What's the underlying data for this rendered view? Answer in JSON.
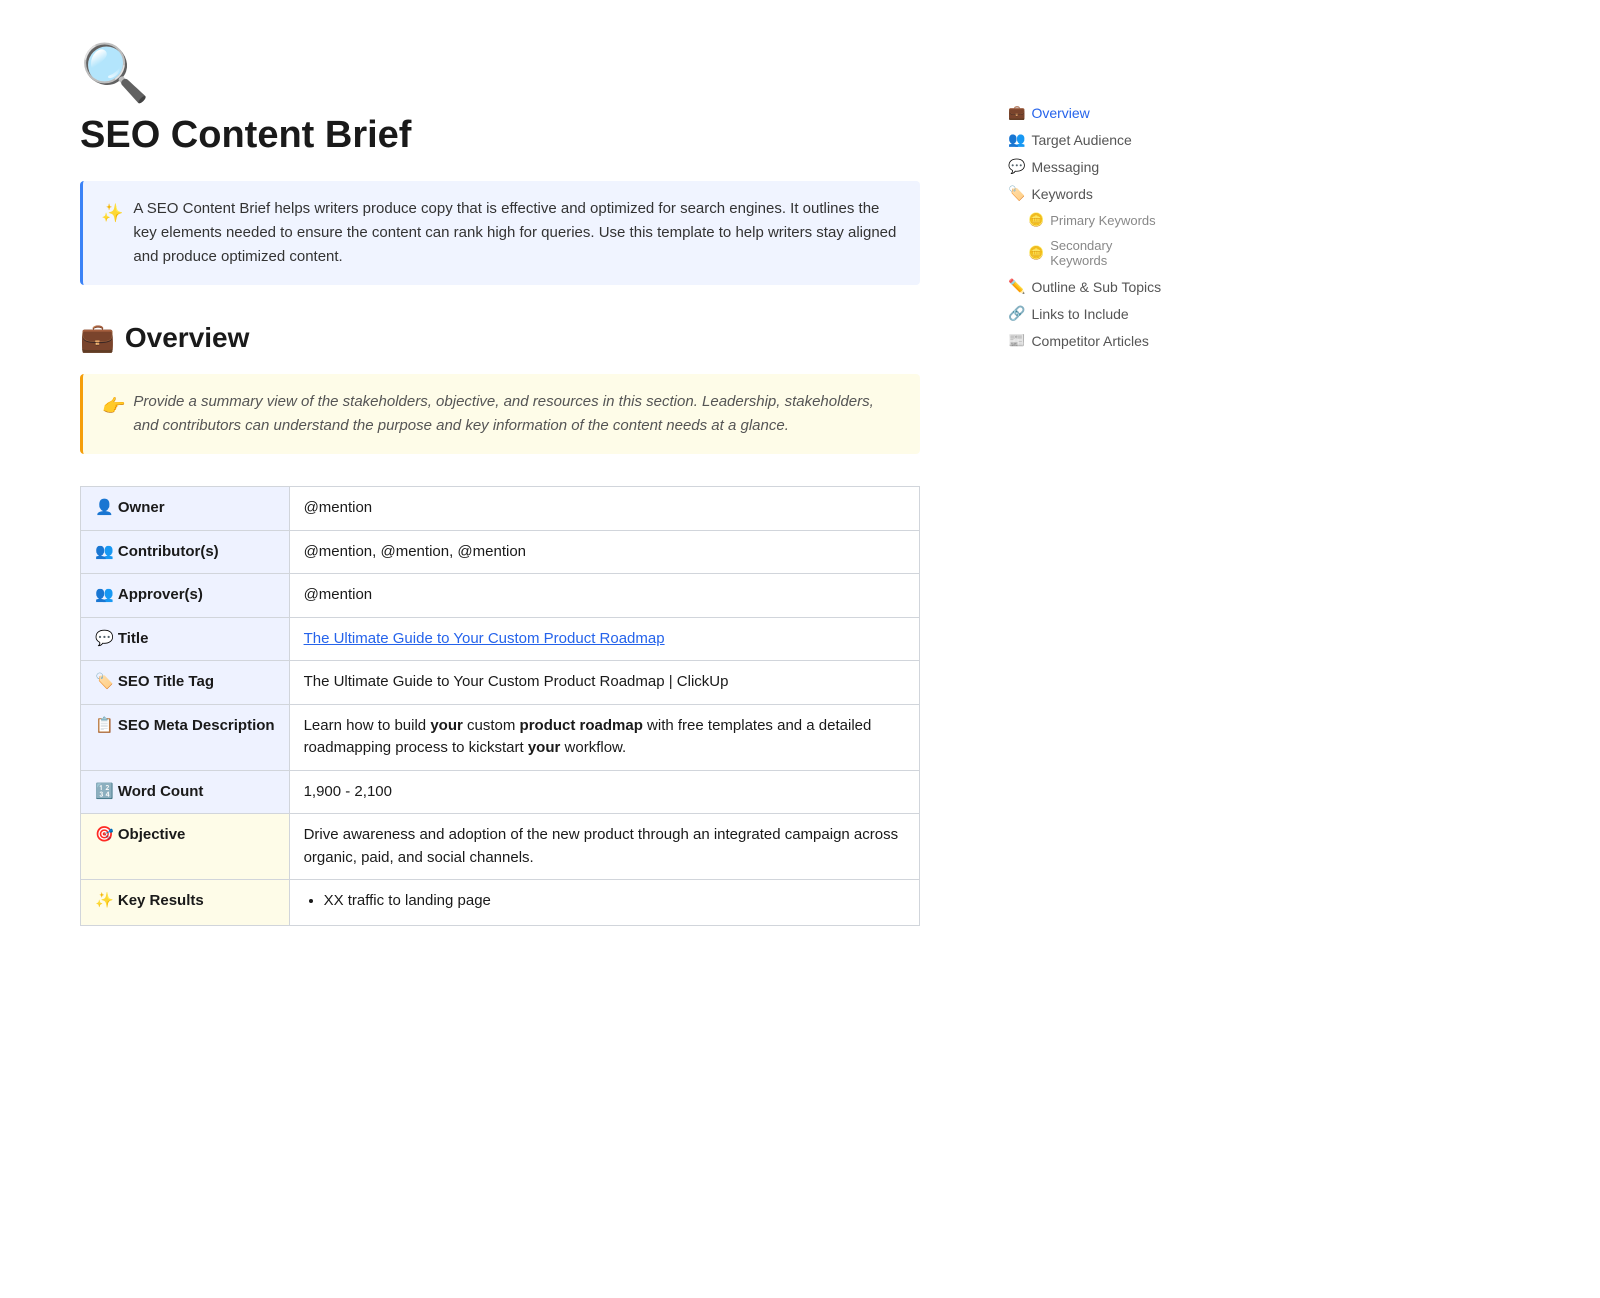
{
  "page": {
    "icon": "🔍",
    "title": "SEO Content Brief",
    "callout_blue": {
      "icon": "✨",
      "text": "A SEO Content Brief helps writers produce copy that is effective and optimized for search engines. It outlines the key elements needed to ensure the content can rank high for queries. Use this template to help writers stay aligned and produce optimized content."
    }
  },
  "sidebar": {
    "items": [
      {
        "id": "overview",
        "icon": "💼",
        "label": "Overview",
        "active": true,
        "sub": false
      },
      {
        "id": "target-audience",
        "icon": "👥",
        "label": "Target Audience",
        "active": false,
        "sub": false
      },
      {
        "id": "messaging",
        "icon": "💬",
        "label": "Messaging",
        "active": false,
        "sub": false
      },
      {
        "id": "keywords",
        "icon": "🏷️",
        "label": "Keywords",
        "active": false,
        "sub": false
      },
      {
        "id": "primary-keywords",
        "icon": "🪙",
        "label": "Primary Keywords",
        "active": false,
        "sub": true
      },
      {
        "id": "secondary-keywords",
        "icon": "🪙",
        "label": "Secondary Keywords",
        "active": false,
        "sub": true
      },
      {
        "id": "outline",
        "icon": "✏️",
        "label": "Outline & Sub Topics",
        "active": false,
        "sub": false
      },
      {
        "id": "links",
        "icon": "🔗",
        "label": "Links to Include",
        "active": false,
        "sub": false
      },
      {
        "id": "competitor",
        "icon": "📰",
        "label": "Competitor Articles",
        "active": false,
        "sub": false
      }
    ]
  },
  "overview": {
    "title": "Overview",
    "title_icon": "💼",
    "callout_yellow": {
      "icon": "👉",
      "text": "Provide a summary view of the stakeholders, objective, and resources in this section. Leadership, stakeholders, and contributors can understand the purpose and key information of the content needs at a glance."
    },
    "table": {
      "rows": [
        {
          "label": "👤 Owner",
          "value": "@mention",
          "style": "normal"
        },
        {
          "label": "👥 Contributor(s)",
          "value": "@mention, @mention, @mention",
          "style": "normal"
        },
        {
          "label": "👥 Approver(s)",
          "value": "@mention",
          "style": "normal"
        },
        {
          "label": "💬 Title",
          "value": "The Ultimate Guide to Your Custom Product Roadmap",
          "style": "link"
        },
        {
          "label": "🏷️ SEO Title Tag",
          "value": "The Ultimate Guide to Your Custom Product Roadmap | ClickUp",
          "style": "normal"
        },
        {
          "label": "📋 SEO Meta Description",
          "value_parts": [
            {
              "text": "Learn how to build ",
              "bold": false
            },
            {
              "text": "your",
              "bold": true
            },
            {
              "text": " custom ",
              "bold": false
            },
            {
              "text": "product roadmap",
              "bold": true
            },
            {
              "text": " with free templates and a detailed roadmapping process to kickstart ",
              "bold": false
            },
            {
              "text": "your",
              "bold": true
            },
            {
              "text": " workflow.",
              "bold": false
            }
          ],
          "style": "rich"
        },
        {
          "label": "🔢 Word Count",
          "value": "1,900 - 2,100",
          "style": "normal"
        },
        {
          "label": "🎯 Objective",
          "value": "Drive awareness and adoption of the new product through an integrated campaign across organic, paid, and social channels.",
          "style": "yellow"
        },
        {
          "label": "✨ Key Results",
          "value": "XX traffic to landing page",
          "style": "bullet-yellow"
        }
      ]
    }
  }
}
